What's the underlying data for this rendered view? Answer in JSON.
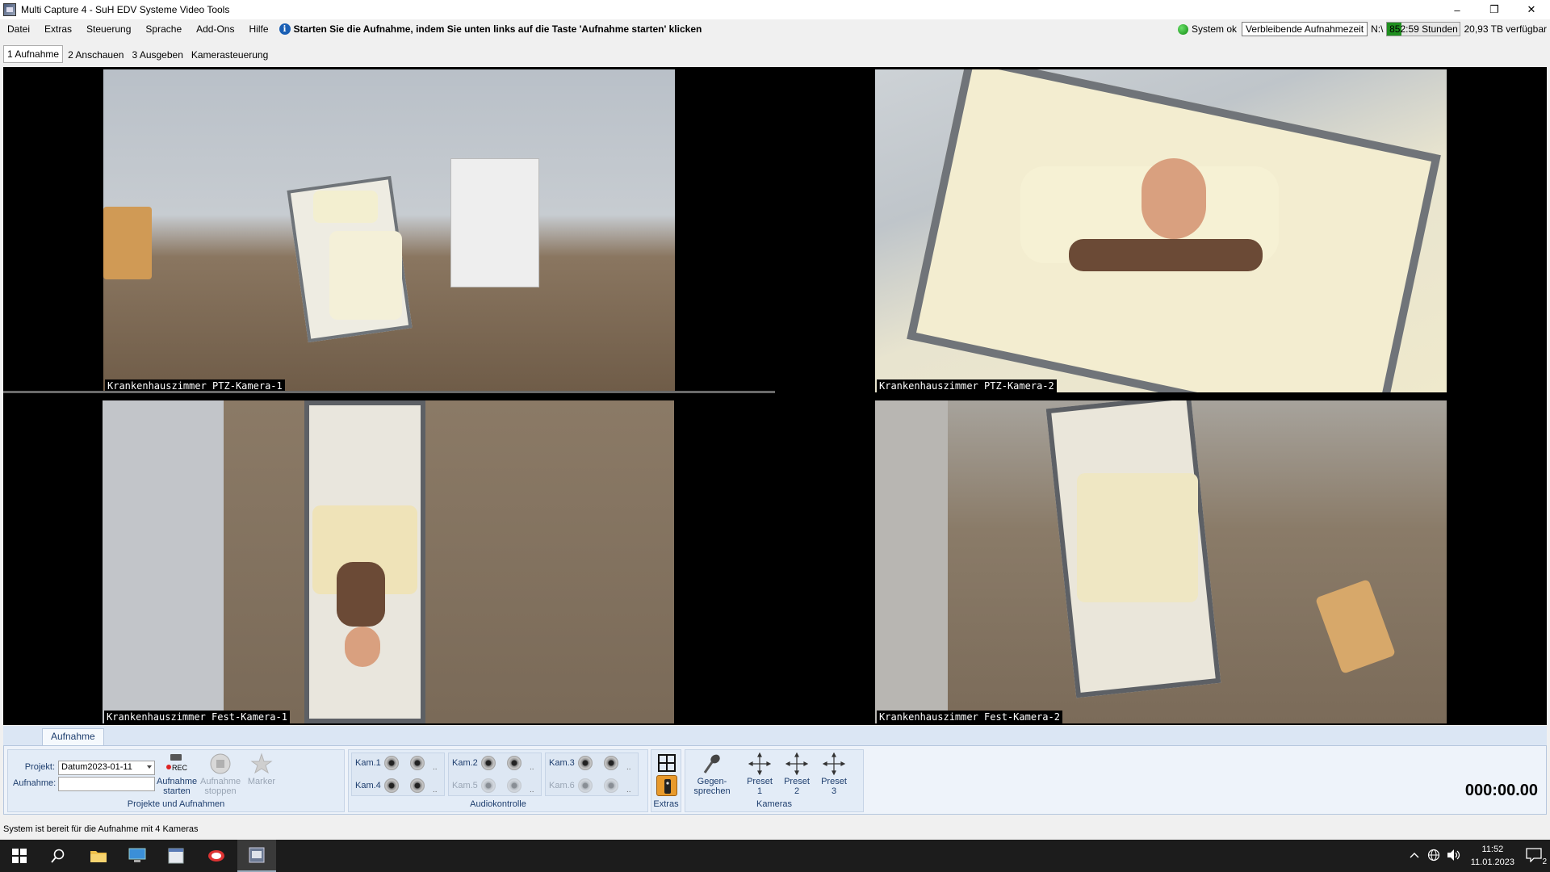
{
  "window": {
    "title": "Multi Capture 4 - SuH EDV Systeme Video Tools",
    "minimize": "–",
    "maximize": "❐",
    "close": "✕"
  },
  "menu": {
    "items": [
      "Datei",
      "Extras",
      "Steuerung",
      "Sprache",
      "Add-Ons",
      "Hilfe"
    ],
    "info_message": "Starten Sie die Aufnahme, indem Sie unten links auf die Taste 'Aufnahme starten' klicken"
  },
  "status": {
    "system": "System ok",
    "remaining_label": "Verbleibende Aufnahmezeit",
    "drive": "N:\\",
    "remaining_time": "852:59 Stunden",
    "remaining_fill": 0.2,
    "free_space": "20,93 TB verfügbar"
  },
  "tabs": [
    "1 Aufnahme",
    "2 Anschauen",
    "3 Ausgeben",
    "Kamerasteuerung"
  ],
  "cameras": [
    {
      "label": "Krankenhauszimmer PTZ-Kamera-1"
    },
    {
      "label": "Krankenhauszimmer PTZ-Kamera-2"
    },
    {
      "label": "Krankenhauszimmer Fest-Kamera-1"
    },
    {
      "label": "Krankenhauszimmer Fest-Kamera-2"
    }
  ],
  "ribbon": {
    "tab": "Aufnahme",
    "projects": {
      "caption": "Projekte und Aufnahmen",
      "project_label": "Projekt:",
      "project_value": "Datum2023-01-11",
      "recording_label": "Aufnahme:",
      "recording_value": "",
      "start_label": "Aufnahme starten",
      "stop_label": "Aufnahme stoppen",
      "marker_label": "Marker",
      "rec_text": "REC"
    },
    "audio": {
      "caption": "Audiokontrolle",
      "channels": [
        "Kam.1",
        "Kam.2",
        "Kam.3",
        "Kam.4",
        "Kam.5",
        "Kam.6"
      ],
      "more": ".."
    },
    "extras": {
      "caption": "Extras"
    },
    "cameras": {
      "caption": "Kameras",
      "talk_label": "Gegen-sprechen",
      "presets": [
        "Preset 1",
        "Preset 2",
        "Preset 3"
      ]
    },
    "timer": "000:00.00"
  },
  "statusline": "System ist bereit für die Aufnahme mit 4 Kameras",
  "taskbar": {
    "time": "11:52",
    "date": "11.01.2023",
    "notifications": "2"
  }
}
